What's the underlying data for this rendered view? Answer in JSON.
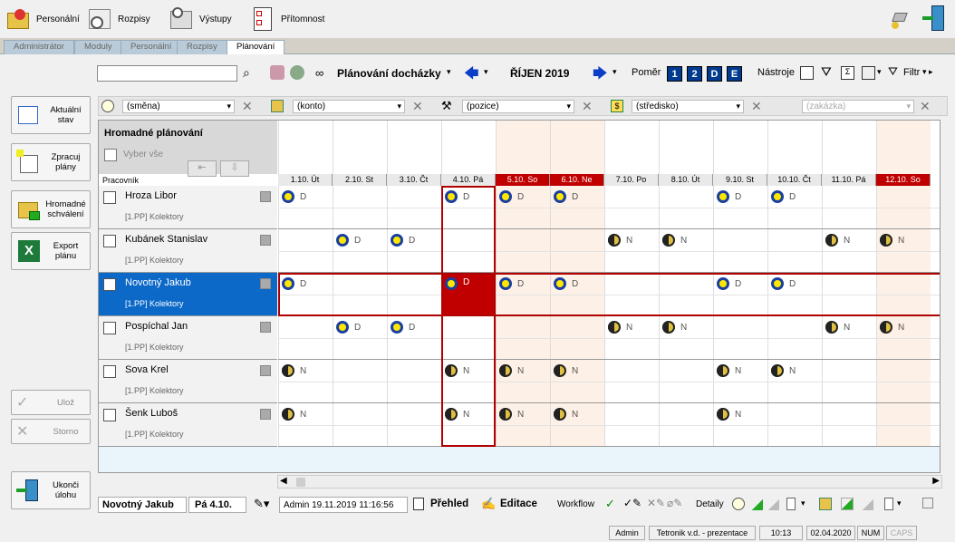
{
  "menu": [
    {
      "label": "Personální",
      "icon": "folder-person-icon"
    },
    {
      "label": "Rozpisy",
      "icon": "clock-calendar-icon"
    },
    {
      "label": "Výstupy",
      "icon": "printer-clock-icon"
    },
    {
      "label": "Přítomnost",
      "icon": "attendance-list-icon"
    }
  ],
  "tabs": [
    "Administrátor",
    "Moduly",
    "Personální",
    "Rozpisy",
    "Plánování"
  ],
  "toolbar": {
    "title": "Plánování docházky",
    "month": "ŘÍJEN 2019",
    "ratio_label": "Poměr",
    "ratio_buttons": [
      "1",
      "2",
      "D",
      "E"
    ],
    "tools_label": "Nástroje",
    "filter_label": "Filtr"
  },
  "nav": [
    {
      "label": "Aktuální stav"
    },
    {
      "label": "Zpracuj plány"
    },
    {
      "label": "Hromadné schválení"
    },
    {
      "label": "Export plánu"
    },
    {
      "label": "Ulož"
    },
    {
      "label": "Storno"
    },
    {
      "label": "Ukonči úlohu"
    }
  ],
  "filters": [
    "(směna)",
    "(konto)",
    "(pozice)",
    "(středisko)",
    "(zakázka)"
  ],
  "grid": {
    "header_title": "Hromadné plánování",
    "select_all": "Vyber vše",
    "employee_col": "Pracovník",
    "days": [
      {
        "label": "1.10. Út",
        "weekend": false
      },
      {
        "label": "2.10. St",
        "weekend": false
      },
      {
        "label": "3.10. Čt",
        "weekend": false
      },
      {
        "label": "4.10. Pá",
        "weekend": false
      },
      {
        "label": "5.10. So",
        "weekend": true
      },
      {
        "label": "6.10. Ne",
        "weekend": true
      },
      {
        "label": "7.10. Po",
        "weekend": false
      },
      {
        "label": "8.10. Út",
        "weekend": false
      },
      {
        "label": "9.10. St",
        "weekend": false
      },
      {
        "label": "10.10. Čt",
        "weekend": false
      },
      {
        "label": "11.10. Pá",
        "weekend": false
      },
      {
        "label": "12.10. So",
        "weekend": true
      }
    ],
    "employees": [
      {
        "name": "Hroza Libor",
        "dept": "[1.PP] Kolektory",
        "shifts": [
          "D",
          "",
          "",
          "D",
          "D",
          "D",
          "",
          "",
          "D",
          "D",
          "",
          ""
        ]
      },
      {
        "name": "Kubánek Stanislav",
        "dept": "[1.PP] Kolektory",
        "shifts": [
          "",
          "D",
          "D",
          "",
          "",
          "",
          "N",
          "N",
          "",
          "",
          "N",
          "N"
        ]
      },
      {
        "name": "Novotný Jakub",
        "dept": "[1.PP] Kolektory",
        "shifts": [
          "D",
          "",
          "",
          "D",
          "D",
          "D",
          "",
          "",
          "D",
          "D",
          "",
          ""
        ],
        "selected": true
      },
      {
        "name": "Pospíchal Jan",
        "dept": "[1.PP] Kolektory",
        "shifts": [
          "",
          "D",
          "D",
          "",
          "",
          "",
          "N",
          "N",
          "",
          "",
          "N",
          "N"
        ]
      },
      {
        "name": "Sova Krel",
        "dept": "[1.PP] Kolektory",
        "shifts": [
          "N",
          "",
          "",
          "N",
          "N",
          "N",
          "",
          "",
          "N",
          "N",
          "",
          ""
        ]
      },
      {
        "name": "Šenk Luboš",
        "dept": "[1.PP] Kolektory",
        "shifts": [
          "N",
          "",
          "",
          "N",
          "N",
          "N",
          "",
          "",
          "N",
          "",
          "",
          " "
        ]
      }
    ]
  },
  "bottom": {
    "employee": "Novotný Jakub",
    "date": "Pá 4.10.",
    "modified": "Admin 19.11.2019 11:16:56",
    "overview": "Přehled",
    "edit": "Editace",
    "workflow": "Workflow",
    "details": "Detaily"
  },
  "status": {
    "user": "Admin",
    "company": "Tetronik v.d. - prezentace",
    "time": "10:13",
    "date": "02.04.2020",
    "num": "NUM",
    "caps": "CAPS"
  }
}
